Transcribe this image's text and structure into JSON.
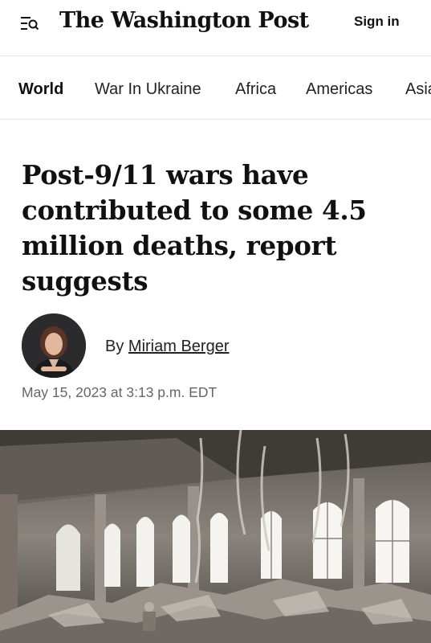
{
  "header": {
    "masthead": "The Washington Post",
    "sign_in": "Sign in"
  },
  "nav": {
    "items": [
      {
        "label": "World",
        "active": true
      },
      {
        "label": "War In Ukraine",
        "active": false
      },
      {
        "label": "Africa",
        "active": false
      },
      {
        "label": "Americas",
        "active": false
      },
      {
        "label": "Asia",
        "active": false
      }
    ]
  },
  "article": {
    "headline_lines": [
      "Post-9/11 wars have",
      "contributed to some 4.5",
      "million deaths, report",
      "suggests"
    ],
    "byline_prefix": "By",
    "author": "Miriam Berger",
    "timestamp": "May 15, 2023 at 3:13 p.m. EDT"
  },
  "icons": {
    "menu": "menu-search-icon"
  },
  "colors": {
    "text": "#111111",
    "secondary_text": "#666666",
    "divider": "#e6e6e6"
  }
}
